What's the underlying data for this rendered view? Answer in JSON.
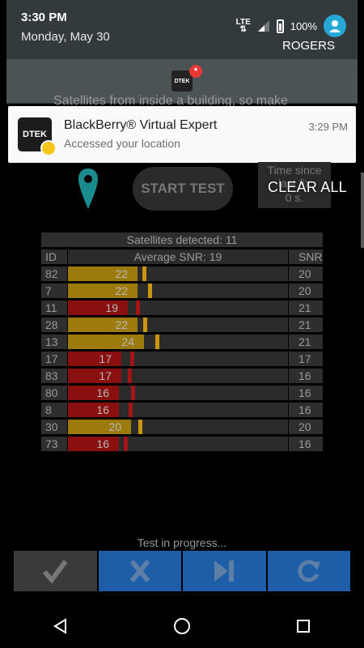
{
  "status_bar": {
    "time": "3:30 PM",
    "date": "Monday, May 30",
    "network": "LTE",
    "battery": "100%",
    "carrier": "ROGERS"
  },
  "collapsed_notification": {
    "app_icon": "dtek-icon",
    "badge": "*"
  },
  "background_peek": "Satellites from inside a building, so make",
  "notification": {
    "icon_text": "DTEK",
    "title": "BlackBerry® Virtual Expert",
    "text": "Accessed your location",
    "time": "3:29 PM"
  },
  "app": {
    "start_test_label": "START TEST",
    "time_since": {
      "line1": "Time since",
      "line2": "last fix",
      "line3": "0 s."
    },
    "clear_all_label": "CLEAR ALL",
    "table": {
      "header": "Satellites detected: 11",
      "col_id": "ID",
      "col_avg": "Average SNR: 19",
      "col_snr": "SNR",
      "max_snr": 50,
      "rows": [
        {
          "id": "82",
          "value": 22,
          "snr": "20",
          "quality": "ok"
        },
        {
          "id": "7",
          "value": 22,
          "snr": "20",
          "quality": "ok"
        },
        {
          "id": "11",
          "value": 19,
          "snr": "21",
          "quality": "weak"
        },
        {
          "id": "28",
          "value": 22,
          "snr": "21",
          "quality": "ok"
        },
        {
          "id": "13",
          "value": 24,
          "snr": "21",
          "quality": "ok"
        },
        {
          "id": "17",
          "value": 17,
          "snr": "17",
          "quality": "weak"
        },
        {
          "id": "83",
          "value": 17,
          "snr": "16",
          "quality": "weak"
        },
        {
          "id": "80",
          "value": 16,
          "snr": "16",
          "quality": "weak"
        },
        {
          "id": "8",
          "value": 16,
          "snr": "16",
          "quality": "weak"
        },
        {
          "id": "30",
          "value": 20,
          "snr": "20",
          "quality": "ok"
        },
        {
          "id": "73",
          "value": 16,
          "snr": "16",
          "quality": "weak"
        }
      ]
    },
    "progress_text": "Test in progress...",
    "toolbar": [
      "check-icon",
      "fail-icon",
      "skip-icon",
      "retry-icon"
    ]
  },
  "nav": [
    "back-icon",
    "home-icon",
    "recents-icon"
  ],
  "colors": {
    "ok_bar": "#9c7a0c",
    "weak_bar": "#8a0f0f",
    "ok_mark": "#c9950c",
    "weak_mark": "#a51515",
    "blue_button": "#1e5ea8",
    "avatar": "#26a8d6",
    "pin": "#1b8c8e"
  }
}
